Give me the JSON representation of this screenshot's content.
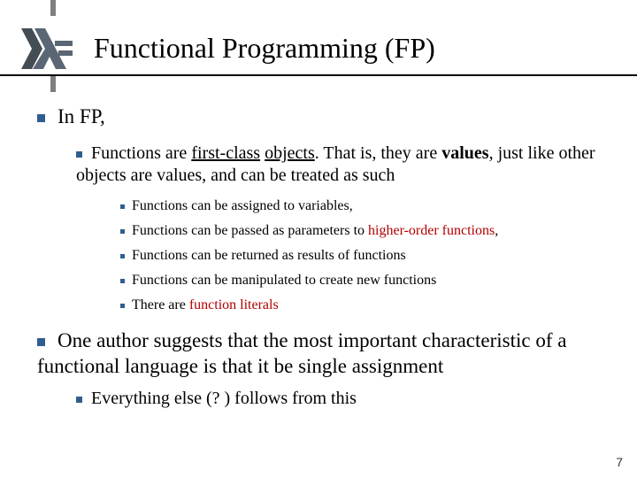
{
  "title": "Functional Programming (FP)",
  "lvl1_a": "In FP,",
  "lvl2_a_pre": "Functions are ",
  "lvl2_a_u1": "first-class",
  "lvl2_a_mid1": " ",
  "lvl2_a_u2": "objects",
  "lvl2_a_mid2": ". That is, they are ",
  "lvl2_a_bold": "values",
  "lvl2_a_post": ", just like other objects are values, and can be treated as such",
  "lvl3_a": "Functions can be assigned to variables,",
  "lvl3_b_pre": "Functions can be passed as parameters to ",
  "lvl3_b_red": "higher-order functions",
  "lvl3_b_post": ",",
  "lvl3_c": "Functions can be returned as results of functions",
  "lvl3_d": "Functions can be manipulated to create new functions",
  "lvl3_e_pre": "There are ",
  "lvl3_e_red": "function literals",
  "lvl1_b": "One author suggests that the most important characteristic of a functional language is that it be single assignment",
  "lvl2_b": "Everything else (? ) follows from this",
  "page": "7"
}
